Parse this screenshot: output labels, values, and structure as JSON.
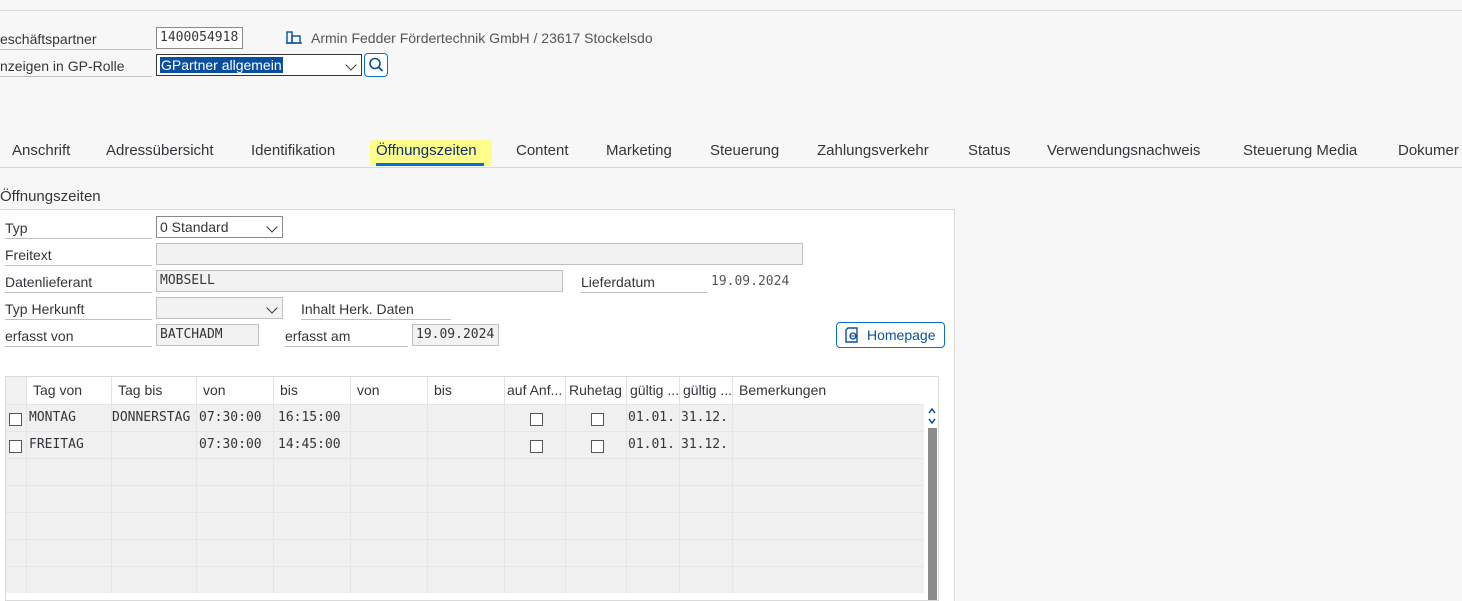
{
  "header": {
    "partner_label": "eschäftspartner",
    "partner_value": "1400054918",
    "partner_name": "Armin Fedder Fördertechnik GmbH / 23617 Stockelsdo",
    "role_label": "nzeigen in GP-Rolle",
    "role_value": "GPartner allgemein",
    "building_icon": "building-icon",
    "search_icon": "search-icon"
  },
  "tabs": [
    {
      "label": "Anschrift"
    },
    {
      "label": "Adressübersicht"
    },
    {
      "label": "Identifikation"
    },
    {
      "label": "Öffnungszeiten"
    },
    {
      "label": "Content"
    },
    {
      "label": "Marketing"
    },
    {
      "label": "Steuerung"
    },
    {
      "label": "Zahlungsverkehr"
    },
    {
      "label": "Status"
    },
    {
      "label": "Verwendungsnachweis"
    },
    {
      "label": "Steuerung Media"
    },
    {
      "label": "Dokumer"
    }
  ],
  "active_tab": "Öffnungszeiten",
  "section": {
    "title": "Öffnungszeiten"
  },
  "form": {
    "typ_label": "Typ",
    "typ_value": "0 Standard",
    "freitext_label": "Freitext",
    "freitext_value": "",
    "datenlieferant_label": "Datenlieferant",
    "datenlieferant_value": "MOBSELL",
    "lieferdatum_label": "Lieferdatum",
    "lieferdatum_value": "19.09.2024",
    "typ_herkunft_label": "Typ Herkunft",
    "typ_herkunft_value": "",
    "inhalt_label": "Inhalt Herk. Daten",
    "erfasst_von_label": "erfasst von",
    "erfasst_von_value": "BATCHADM",
    "erfasst_am_label": "erfasst am",
    "erfasst_am_value": "19.09.2024",
    "homepage_button": "Homepage"
  },
  "table": {
    "columns": [
      "Tag von",
      "Tag bis",
      "von",
      "bis",
      "von",
      "bis",
      "auf Anf...",
      "Ruhetag",
      "gültig ...",
      "gültig ...",
      "Bemerkungen"
    ],
    "rows": [
      {
        "tag_von": "MONTAG",
        "tag_bis": "DONNERSTAG",
        "von1": "07:30:00",
        "bis1": "16:15:00",
        "von2": "",
        "bis2": "",
        "gueltig_ab": "01.01.",
        "gueltig_bis": "31.12.",
        "bemerkungen": ""
      },
      {
        "tag_von": "FREITAG",
        "tag_bis": "",
        "von1": "07:30:00",
        "bis1": "14:45:00",
        "von2": "",
        "bis2": "",
        "gueltig_ab": "01.01.",
        "gueltig_bis": "31.12.",
        "bemerkungen": ""
      }
    ]
  },
  "colors": {
    "active_tab_underline": "#0a6ed1",
    "highlight": "#ffff66",
    "selection": "#0a4f9e"
  }
}
